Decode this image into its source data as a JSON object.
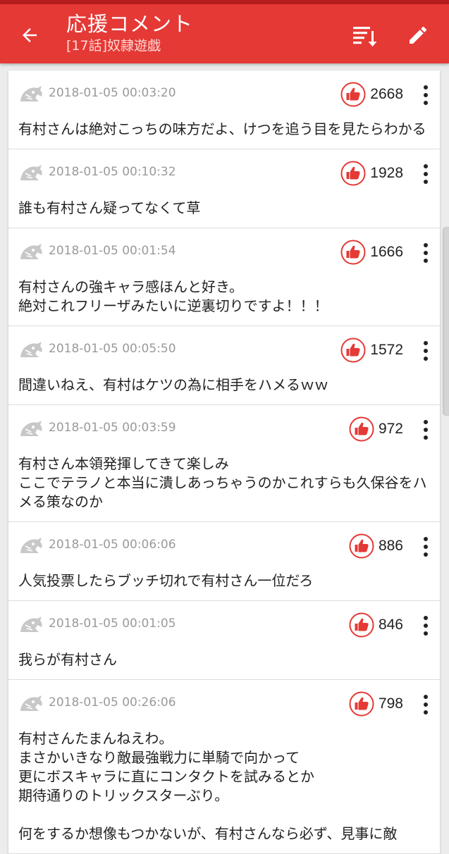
{
  "header": {
    "title": "応援コメント",
    "subtitle": "[17話]奴隷遊戯",
    "back_icon": "arrow-left-icon",
    "sort_icon": "sort-icon",
    "edit_icon": "pencil-icon"
  },
  "colors": {
    "app_bar": "#e53935",
    "status_strip": "#b71c1c",
    "like_accent": "#e53935",
    "timestamp": "#9a9a9a"
  },
  "comments": [
    {
      "timestamp": "2018-01-05 00:03:20",
      "likes": "2668",
      "text": "有村さんは絶対こっちの味方だよ、けつを追う目を見たらわかる"
    },
    {
      "timestamp": "2018-01-05 00:10:32",
      "likes": "1928",
      "text": "誰も有村さん疑ってなくて草"
    },
    {
      "timestamp": "2018-01-05 00:01:54",
      "likes": "1666",
      "text": "有村さんの強キャラ感ほんと好き。\n絶対これフリーザみたいに逆裏切りですよ！！！"
    },
    {
      "timestamp": "2018-01-05 00:05:50",
      "likes": "1572",
      "text": "間違いねえ、有村はケツの為に相手をハメるｗｗ"
    },
    {
      "timestamp": "2018-01-05 00:03:59",
      "likes": "972",
      "text": "有村さん本領発揮してきて楽しみ\nここでテラノと本当に潰しあっちゃうのかこれすらも久保谷をハメる策なのか"
    },
    {
      "timestamp": "2018-01-05 00:06:06",
      "likes": "886",
      "text": "人気投票したらブッチ切れで有村さん一位だろ"
    },
    {
      "timestamp": "2018-01-05 00:01:05",
      "likes": "846",
      "text": "我らが有村さん"
    },
    {
      "timestamp": "2018-01-05 00:26:06",
      "likes": "798",
      "text": "有村さんたまんねえわ。\nまさかいきなり敵最強戦力に単騎で向かって\n更にボスキャラに直にコンタクトを試みるとか\n期待通りのトリックスターぶり。\n\n何をするか想像もつかないが、有村さんなら必ず、見事に敵"
    }
  ]
}
